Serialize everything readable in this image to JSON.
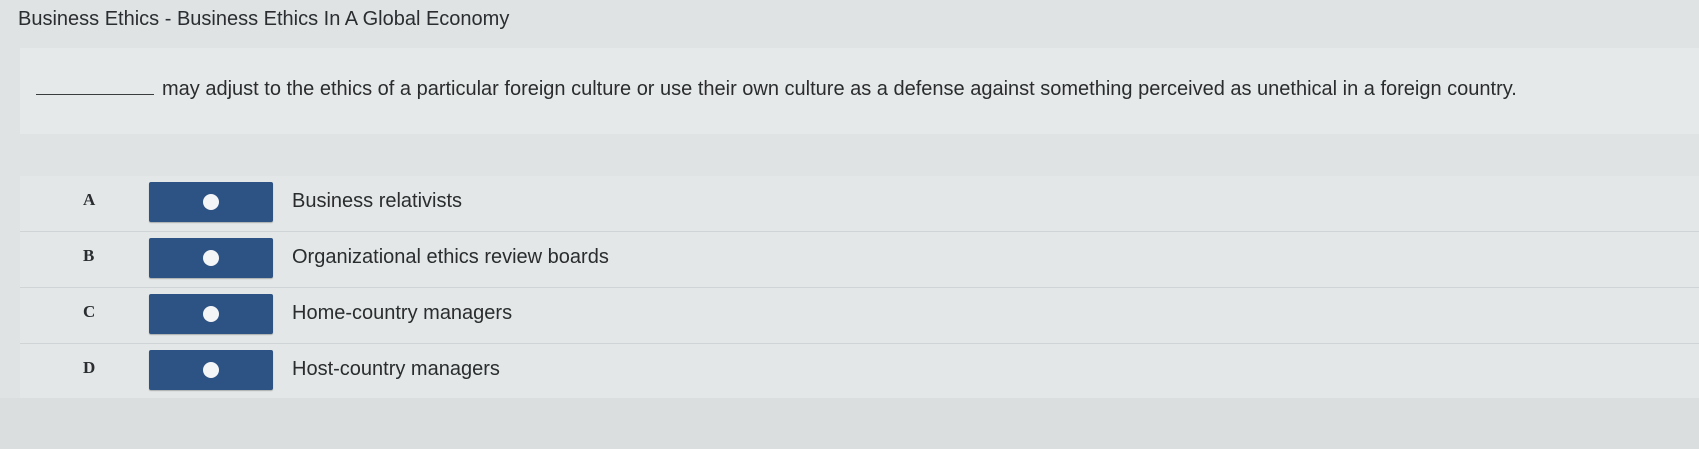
{
  "header": {
    "title": "Business Ethics - Business Ethics In A Global Economy"
  },
  "question": {
    "text": "may adjust to the ethics of a particular foreign culture or use their own culture as a defense against something perceived as unethical in a foreign country."
  },
  "options": [
    {
      "letter": "A",
      "label": "Business relativists"
    },
    {
      "letter": "B",
      "label": "Organizational ethics review boards"
    },
    {
      "letter": "C",
      "label": "Home-country managers"
    },
    {
      "letter": "D",
      "label": "Host-country managers"
    }
  ],
  "colors": {
    "radio_button": "#2d5384",
    "background": "#dfe3e4"
  }
}
